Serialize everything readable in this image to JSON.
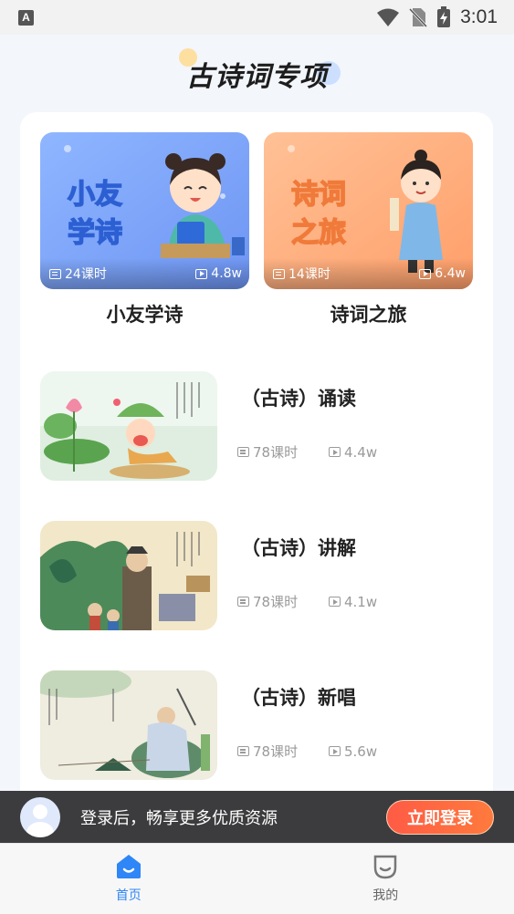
{
  "status_bar": {
    "notification_icon": "A",
    "time": "3:01"
  },
  "header": {
    "title": "古诗词专项"
  },
  "featured": [
    {
      "title": "小友学诗",
      "cover_text": [
        "小友",
        "学诗"
      ],
      "lessons": "24课时",
      "views": "4.8w",
      "color": "#7fa8ff"
    },
    {
      "title": "诗词之旅",
      "cover_text": [
        "诗词",
        "之旅"
      ],
      "lessons": "14课时",
      "views": "6.4w",
      "color": "#ffae7a"
    }
  ],
  "courses": [
    {
      "title": "（古诗）诵读",
      "lessons": "78课时",
      "views": "4.4w"
    },
    {
      "title": "（古诗）讲解",
      "lessons": "78课时",
      "views": "4.1w"
    },
    {
      "title": "（古诗）新唱",
      "lessons": "78课时",
      "views": "5.6w"
    }
  ],
  "login_banner": {
    "text": "登录后，畅享更多优质资源",
    "button": "立即登录"
  },
  "nav": {
    "home": "首页",
    "mine": "我的"
  },
  "colors": {
    "accent": "#2f86f6",
    "login_button": "#ff5b45"
  }
}
